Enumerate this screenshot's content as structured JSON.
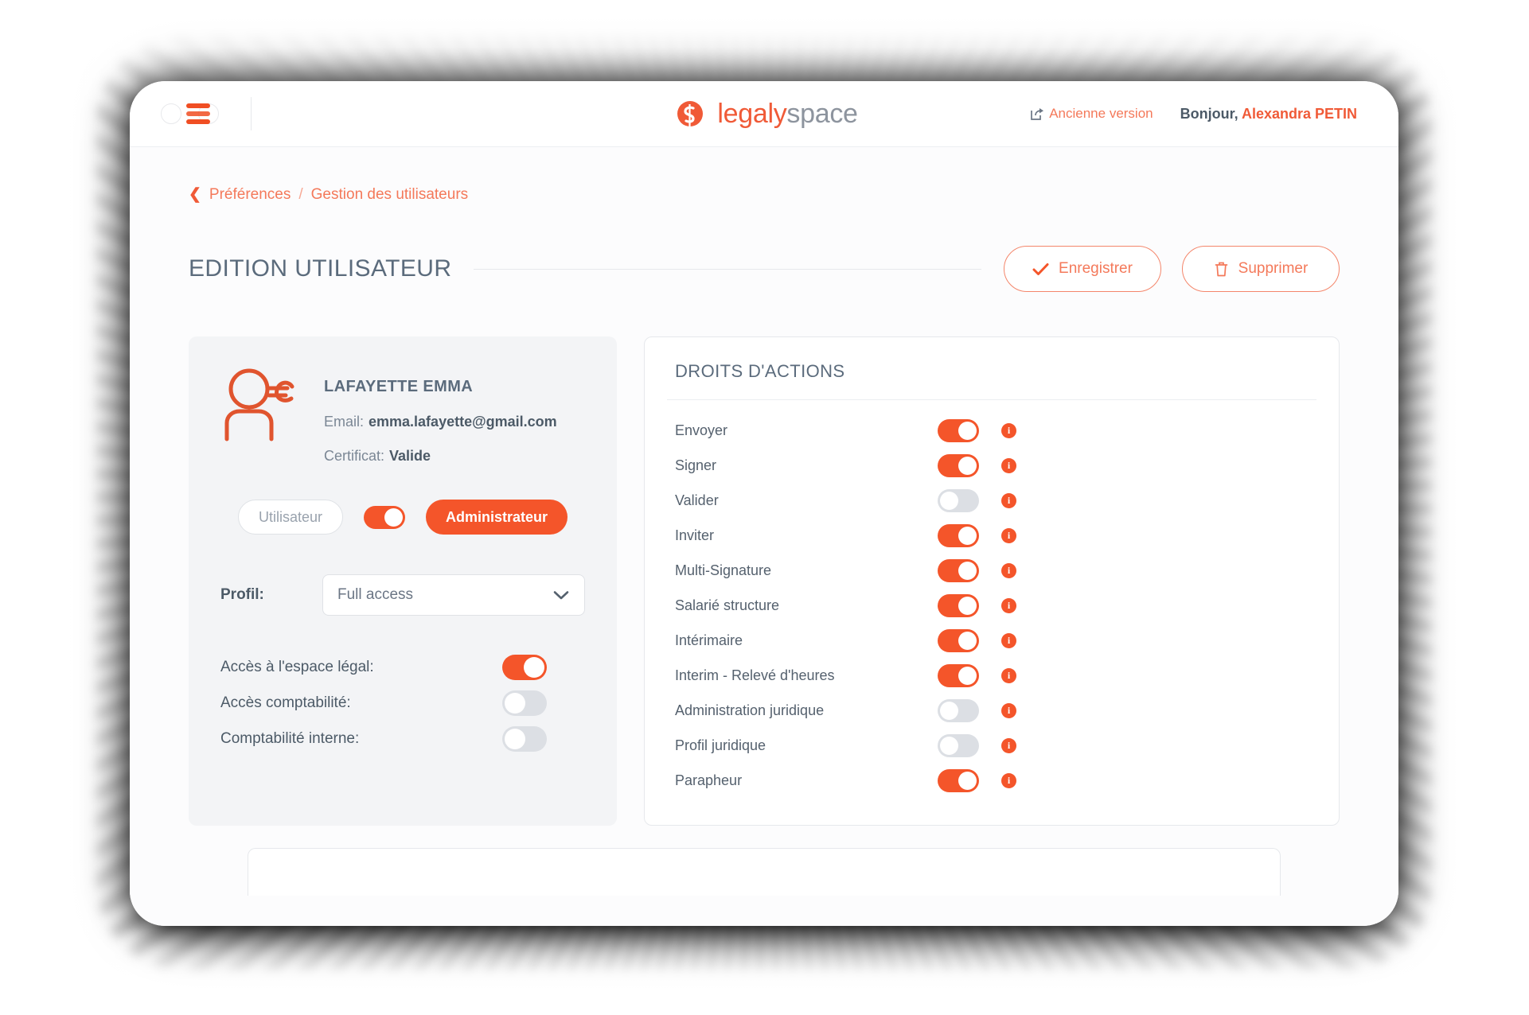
{
  "topbar": {
    "menu_icon": "hamburger-icon",
    "logo": {
      "part1": "legaly",
      "part2": "space",
      "mark": "legalyspace-s-mark"
    },
    "old_version_label": "Ancienne version",
    "old_version_icon": "share-external-icon",
    "greeting_prefix": "Bonjour, ",
    "user_name": "Alexandra PETIN"
  },
  "breadcrumb": {
    "back_icon": "chevron-left-icon",
    "parent": "Préférences",
    "separator": "/",
    "current": "Gestion des utilisateurs"
  },
  "page": {
    "title": "EDITION UTILISATEUR",
    "save_label": "Enregistrer",
    "save_icon": "check-icon",
    "delete_label": "Supprimer",
    "delete_icon": "trash-icon"
  },
  "user_card": {
    "avatar_icon": "user-euro-icon",
    "name": "LAFAYETTE EMMA",
    "email_label": "Email:",
    "email_value": "emma.lafayette@gmail.com",
    "certificat_label": "Certificat:",
    "certificat_value": "Valide",
    "role_user_label": "Utilisateur",
    "role_toggle_on": true,
    "role_admin_label": "Administrateur",
    "profil_label": "Profil:",
    "profil_value": "Full access",
    "profil_chevron": "chevron-down-icon",
    "access": [
      {
        "label": "Accès à l'espace légal:",
        "on": true
      },
      {
        "label": "Accès comptabilité:",
        "on": false
      },
      {
        "label": "Comptabilité interne:",
        "on": false
      }
    ]
  },
  "rights_card": {
    "title": "DROITS D'ACTIONS",
    "info_glyph": "i",
    "rows": [
      {
        "label": "Envoyer",
        "on": true
      },
      {
        "label": "Signer",
        "on": true
      },
      {
        "label": "Valider",
        "on": false
      },
      {
        "label": "Inviter",
        "on": true
      },
      {
        "label": "Multi-Signature",
        "on": true
      },
      {
        "label": "Salarié structure",
        "on": true
      },
      {
        "label": "Intérimaire",
        "on": true
      },
      {
        "label": "Interim - Relevé d'heures",
        "on": true
      },
      {
        "label": "Administration juridique",
        "on": false
      },
      {
        "label": "Profil juridique",
        "on": false
      },
      {
        "label": "Parapheur",
        "on": true
      }
    ]
  },
  "colors": {
    "accent": "#f4552a",
    "accent_light": "#f4795a",
    "title": "#5b6b7c",
    "card_bg": "#f3f4f6"
  }
}
